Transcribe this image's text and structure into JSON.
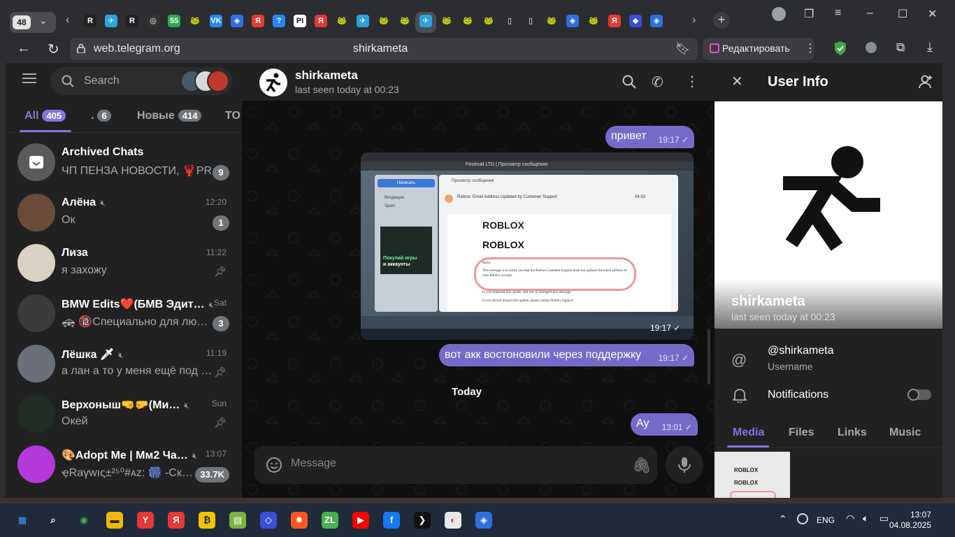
{
  "browser": {
    "tab_count": "48",
    "url": "web.telegram.org",
    "page_title": "shirkameta",
    "edit_label": "Редактировать",
    "tabs": [
      {
        "label": "R",
        "color": "#ffffff",
        "bg": "#222222"
      },
      {
        "label": "✈",
        "color": "#ffffff",
        "bg": "#2aa3df"
      },
      {
        "label": "R",
        "color": "#ffffff",
        "bg": "#222222"
      },
      {
        "label": "◎",
        "color": "#ffffff",
        "bg": "#333333"
      },
      {
        "label": "55",
        "color": "#ffffff",
        "bg": "#2ba84a"
      },
      {
        "label": "🐸",
        "color": "#ffffff",
        "bg": "#2b2d31"
      },
      {
        "label": "VK",
        "color": "#ffffff",
        "bg": "#2787f5"
      },
      {
        "label": "◈",
        "color": "#ffffff",
        "bg": "#2f6fe0"
      },
      {
        "label": "Я",
        "color": "#ffffff",
        "bg": "#e53935"
      },
      {
        "label": "?",
        "color": "#ffffff",
        "bg": "#2787f5"
      },
      {
        "label": "PI",
        "color": "#222222",
        "bg": "#ffffff"
      },
      {
        "label": "Я",
        "color": "#ffffff",
        "bg": "#e53935"
      },
      {
        "label": "🐸",
        "color": "#ffffff",
        "bg": "#2b2d31"
      },
      {
        "label": "✈",
        "color": "#ffffff",
        "bg": "#2aa3df"
      },
      {
        "label": "🐸",
        "color": "#ffffff",
        "bg": "#2b2d31"
      },
      {
        "label": "🐸",
        "color": "#ffffff",
        "bg": "#2b2d31"
      },
      {
        "label": "✈",
        "color": "#ffffff",
        "bg": "#2aa3df"
      },
      {
        "label": "🐸",
        "color": "#ffffff",
        "bg": "#2b2d31"
      },
      {
        "label": "🐸",
        "color": "#ffffff",
        "bg": "#2b2d31"
      },
      {
        "label": "🐸",
        "color": "#ffffff",
        "bg": "#2b2d31"
      },
      {
        "label": "▯",
        "color": "#ffffff",
        "bg": "#2b2d31"
      },
      {
        "label": "▯",
        "color": "#ffffff",
        "bg": "#2b2d31"
      },
      {
        "label": "🐸",
        "color": "#ffffff",
        "bg": "#2b2d31"
      },
      {
        "label": "◈",
        "color": "#ffffff",
        "bg": "#2f6fe0"
      },
      {
        "label": "🐸",
        "color": "#ffffff",
        "bg": "#2b2d31"
      },
      {
        "label": "Я",
        "color": "#ffffff",
        "bg": "#e53935"
      },
      {
        "label": "◆",
        "color": "#ffffff",
        "bg": "#3a4fd8"
      },
      {
        "label": "◈",
        "color": "#ffffff",
        "bg": "#2f6fe0"
      }
    ]
  },
  "sidebar": {
    "search_placeholder": "Search",
    "folders": [
      {
        "label": "All",
        "count": "405"
      },
      {
        "label": ".",
        "count": "6"
      },
      {
        "label": "Новые",
        "count": "414"
      },
      {
        "label": "TO",
        "count": ""
      }
    ],
    "chats": [
      {
        "name": "Archived Chats",
        "message": "ЧП ПЕНЗА НОВОСТИ, 🦞PR",
        "time": "",
        "badge": "9",
        "pinned": false,
        "muted": false,
        "avatar": "#5a5a5a"
      },
      {
        "name": "Алёна",
        "message": "Ок",
        "time": "12:20",
        "badge": "1",
        "pinned": false,
        "muted": true,
        "avatar": "#6b4b3a"
      },
      {
        "name": "Лиза",
        "message": "я захожу",
        "time": "11:22",
        "badge": "",
        "pinned": true,
        "muted": false,
        "avatar": "#d9d2c3"
      },
      {
        "name": "BMW Edits❤️(БМВ Эдит…",
        "message": "🚓 🔞Специально для лю…",
        "time": "Sat",
        "badge": "3",
        "pinned": false,
        "muted": true,
        "avatar": "#3b3b3b"
      },
      {
        "name": "Лёшка 🗡",
        "message": "а лан а то у меня ещё под …",
        "time": "11:19",
        "badge": "",
        "pinned": true,
        "muted": true,
        "avatar": "#6b6f7a"
      },
      {
        "name": "Верхоныш🤜🤛(Ми…",
        "message": "Окей",
        "time": "Sun",
        "badge": "",
        "pinned": true,
        "muted": true,
        "avatar": "#1f2d22"
      },
      {
        "name": "🎨Adopt Me | Мм2 Ча…",
        "message": "ҿRaγwıς±²⁵⁰#ᴀz: 🎆 -Ск…",
        "time": "13:07",
        "badge": "33.7K",
        "pinned": false,
        "muted": true,
        "avatar": "#b43ad9"
      }
    ]
  },
  "chat": {
    "name": "shirkameta",
    "status": "last seen today at 00:23",
    "messages": [
      {
        "text": "привет",
        "time": "19:17"
      },
      {
        "text": "",
        "time": "19:17"
      },
      {
        "text": "вот акк востоновили через поддержку",
        "time": "19:17"
      },
      {
        "text": "Ау",
        "time": "13:01"
      }
    ],
    "day_separator": "Today",
    "input_placeholder": "Message",
    "screenshot": {
      "brand_1": "ROBLOX",
      "brand_2": "ROBLOX",
      "email_subject": "Roblox: Email Address Updated by Customer Support",
      "email_time": "04:53",
      "greeting": "Hello,",
      "body_1": "This message is to notify you that the Roblox Customer Support team has updated the email address on your Roblox account.",
      "body_2": "If you requested this update, feel free to disregard this message.",
      "body_3": "If you did not request this update, please contact Roblox Support",
      "sidebar_btn": "Написать",
      "inbox_label": "Входящие",
      "spam_label": "Spam",
      "promo_line1": "Покупай игры",
      "promo_line2": "и аккаунты",
      "tab_title": "Firstmail LTD | Просмотр сообщения",
      "header_label": "Просмотр сообщения"
    }
  },
  "userinfo": {
    "title": "User Info",
    "name": "shirkameta",
    "last_seen": "last seen today at 00:23",
    "username": "@shirkameta",
    "username_label": "Username",
    "notifications_label": "Notifications",
    "notifications_on": false,
    "media_tabs": [
      "Media",
      "Files",
      "Links",
      "Music"
    ],
    "thumb_text_1": "ROBLOX",
    "thumb_text_2": "ROBLOX"
  },
  "taskbar": {
    "apps": [
      {
        "label": "▦",
        "bg": "#1f2a3a",
        "color": "#3fa0ff"
      },
      {
        "label": "⌕",
        "bg": "#1f2a3a",
        "color": "#ffffff"
      },
      {
        "label": "◉",
        "bg": "#1f2a3a",
        "color": "#4caf50"
      },
      {
        "label": "▬",
        "bg": "#f2b705",
        "color": "#1f2a3a"
      },
      {
        "label": "Y",
        "bg": "#e53935",
        "color": "#ffffff"
      },
      {
        "label": "Я",
        "bg": "#e53935",
        "color": "#ffffff"
      },
      {
        "label": "₿",
        "bg": "#f5c400",
        "color": "#1f2a3a"
      },
      {
        "label": "▤",
        "bg": "#7cb342",
        "color": "#ffffff"
      },
      {
        "label": "◇",
        "bg": "#3a4fd8",
        "color": "#ffffff"
      },
      {
        "label": "✹",
        "bg": "#ff5722",
        "color": "#ffffff"
      },
      {
        "label": "ZL",
        "bg": "#4caf50",
        "color": "#ffffff"
      },
      {
        "label": "▶",
        "bg": "#ff0000",
        "color": "#ffffff"
      },
      {
        "label": "f",
        "bg": "#1877f2",
        "color": "#ffffff"
      },
      {
        "label": "❯",
        "bg": "#111111",
        "color": "#ffffff"
      },
      {
        "label": "◐",
        "bg": "#e8e8e8",
        "color": "#d32f2f"
      },
      {
        "label": "◈",
        "bg": "#2f6fe0",
        "color": "#ffffff"
      }
    ],
    "language": "ENG",
    "time": "13:07",
    "date": "04.08.2025"
  }
}
